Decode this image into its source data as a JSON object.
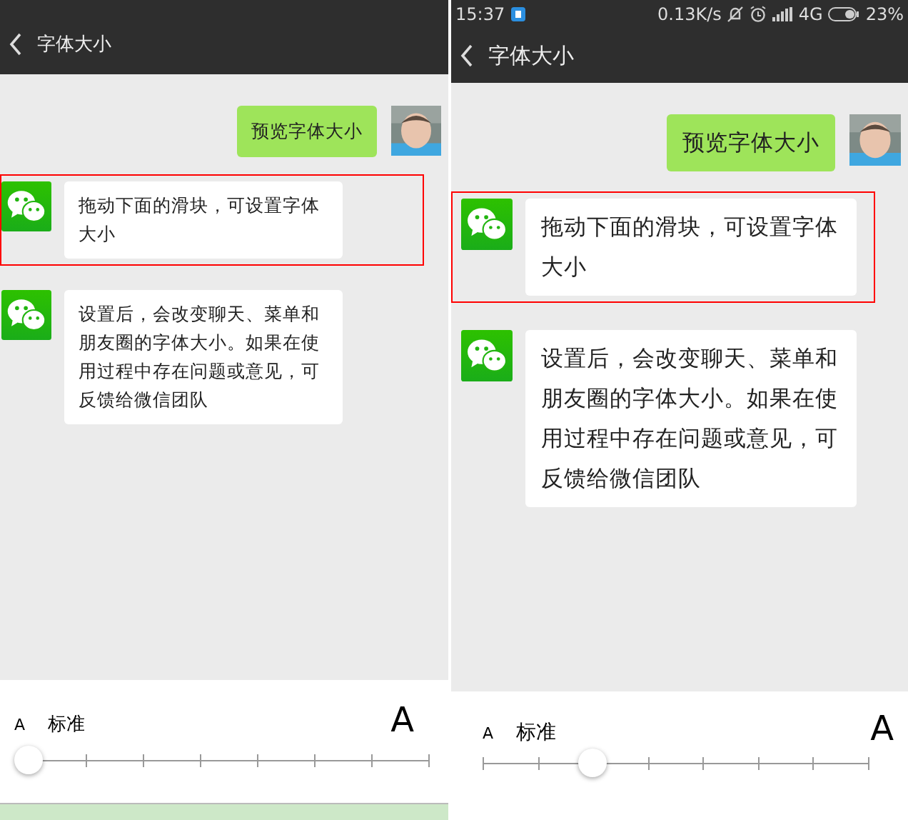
{
  "panels": [
    {
      "title": "字体大小",
      "messages": [
        {
          "kind": "outgoing",
          "text": "预览字体大小",
          "highlighted": false
        },
        {
          "kind": "incoming",
          "text": "拖动下面的滑块，可设置字体大小",
          "highlighted": true
        },
        {
          "kind": "incoming",
          "text": "设置后，会改变聊天、菜单和朋友圈的字体大小。如果在使用过程中存在问题或意见，可反馈给微信团队",
          "highlighted": false
        }
      ],
      "slider": {
        "small_label": "A",
        "current_label": "标准",
        "large_label": "A",
        "level": 0
      }
    },
    {
      "status_bar": {
        "time": "15:37",
        "speed": "0.13K/s",
        "network": "4G",
        "battery": "23%"
      },
      "title": "字体大小",
      "messages": [
        {
          "kind": "outgoing",
          "text": "预览字体大小",
          "highlighted": false
        },
        {
          "kind": "incoming",
          "text": "拖动下面的滑块，可设置字体大小",
          "highlighted": true
        },
        {
          "kind": "incoming",
          "text": "设置后，会改变聊天、菜单和朋友圈的字体大小。如果在使用过程中存在问题或意见，可反馈给微信团队",
          "highlighted": false
        }
      ],
      "slider": {
        "small_label": "A",
        "current_label": "标准",
        "large_label": "A",
        "level": 0.2857
      }
    }
  ]
}
